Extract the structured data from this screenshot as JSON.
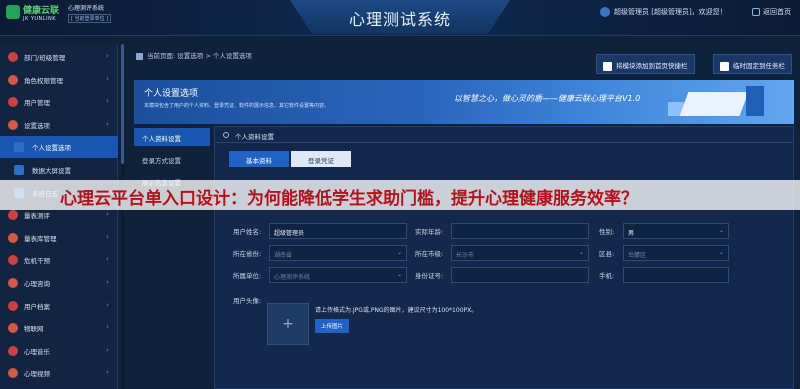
{
  "brand": {
    "name": "健康云联",
    "english": "JK YUNLINK",
    "system": "心理测评系统",
    "version": "[ 当前登录单位 ]"
  },
  "header": {
    "title": "心理测试系统",
    "user_text": "超级管理员 [超级管理员]，欢迎您！",
    "back_label": "返回首页"
  },
  "sidebar": {
    "items": [
      {
        "label": "部门/班级管理",
        "icon": "department-icon",
        "color": "#c94242"
      },
      {
        "label": "角色权限管理",
        "icon": "role-icon",
        "color": "#d2584a"
      },
      {
        "label": "用户管理",
        "icon": "user-icon",
        "color": "#c94242"
      },
      {
        "label": "设置选项",
        "icon": "settings-icon",
        "color": "#d2584a"
      },
      {
        "label": "个人设置选项",
        "icon": "personal-settings-icon",
        "color": "#2b6fc7",
        "active": true,
        "sub": true
      },
      {
        "label": "数据大屏设置",
        "icon": "dashboard-icon",
        "color": "#2b6fc7",
        "sub": true
      },
      {
        "label": "系统日志",
        "icon": "log-icon",
        "color": "#2b6fc7",
        "sub": true
      },
      {
        "label": "量表测评",
        "icon": "assessment-icon",
        "color": "#c94242"
      },
      {
        "label": "量表库管理",
        "icon": "scale-library-icon",
        "color": "#d2584a"
      },
      {
        "label": "危机干预",
        "icon": "crisis-icon",
        "color": "#c94242"
      },
      {
        "label": "心理咨询",
        "icon": "counseling-icon",
        "color": "#d2584a"
      },
      {
        "label": "用户档案",
        "icon": "archive-icon",
        "color": "#c94242"
      },
      {
        "label": "物联网",
        "icon": "iot-icon",
        "color": "#d2584a"
      },
      {
        "label": "心理音乐",
        "icon": "music-icon",
        "color": "#c94242"
      },
      {
        "label": "心理视频",
        "icon": "video-icon",
        "color": "#d2584a"
      }
    ]
  },
  "breadcrumb": "当前页面: 设置选项 > 个人设置选项",
  "quick": {
    "add_label": "将模块添加到首页快捷栏",
    "pin_label": "临时固定到任务栏"
  },
  "banner": {
    "title": "个人设置选项",
    "desc": "本模块包含了用户的个人资料、登录凭证、软件的展示信息、其它软件设置等内容。",
    "slogan": "以智慧之心，做心灵的盾——健康云联心理平台V1.0"
  },
  "side_tabs": [
    {
      "label": "个人资料设置",
      "active": true
    },
    {
      "label": "登录方式设置"
    },
    {
      "label": "展示信息设置"
    }
  ],
  "panel": {
    "title": "个人资料设置",
    "tab_basic": "基本资料",
    "tab_login": "登录凭证"
  },
  "form": {
    "username_label": "用户姓名:",
    "username_value": "超级管理员",
    "age_label": "实际年龄:",
    "age_value": "",
    "gender_label": "性别:",
    "gender_value": "男",
    "province_label": "所在省份:",
    "province_placeholder": "湖南省",
    "city_label": "所在市级:",
    "city_placeholder": "长沙市",
    "district_label": "区县:",
    "district_placeholder": "岳麓区",
    "org_label": "所属单位:",
    "org_placeholder": "心理测评系统",
    "idcard_label": "身份证号:",
    "idcard_value": "",
    "phone_label": "手机:",
    "phone_value": "",
    "avatar_label": "用户头像:",
    "upload_hint": "请上传格式为.JPG或.PNG的图片，建议尺寸为100*100PX。",
    "upload_button": "上传图片"
  },
  "overlay": {
    "text": "心理云平台单入口设计：为何能降低学生求助门槛，提升心理健康服务效率？"
  }
}
